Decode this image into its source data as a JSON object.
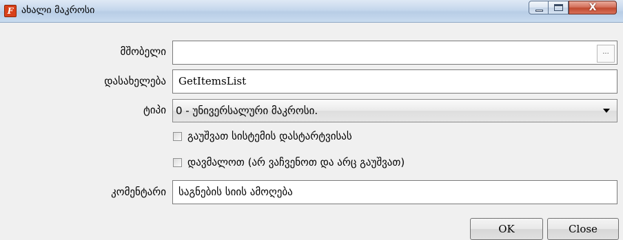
{
  "window": {
    "title": "ახალი მაკროსი",
    "app_icon_glyph": "F",
    "controls": {
      "close_glyph": "X"
    }
  },
  "form": {
    "parent": {
      "label": "მშობელი",
      "value": "",
      "browse_label": "..."
    },
    "name": {
      "label": "დასახელება",
      "value": "GetItemsList"
    },
    "type": {
      "label": "ტიპი",
      "selected": "0 - უნივერსალური მაკროსი."
    },
    "run_on_startup": {
      "label": "გაუშვათ სისტემის დასტარტვისას",
      "checked": false
    },
    "hide": {
      "label": "დავმალოთ (არ ვაჩვენოთ და არც გაუშვათ)",
      "checked": false
    },
    "comment": {
      "label": "კომენტარი",
      "value": "საგნების სიის ამოღება"
    }
  },
  "buttons": {
    "ok": "OK",
    "close": "Close"
  },
  "colors": {
    "close_button": "#c04a30",
    "titlebar": "#c5d7ec",
    "background": "#f0f0f0"
  }
}
